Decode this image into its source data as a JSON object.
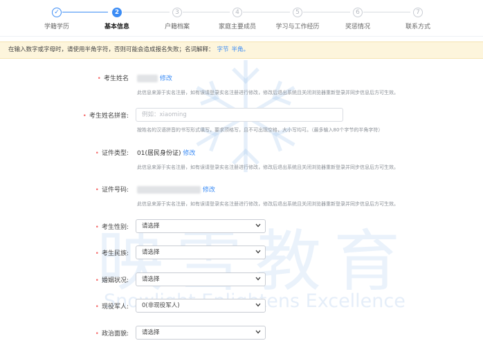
{
  "steps": [
    {
      "num": "✓",
      "label": "学籍学历",
      "state": "done"
    },
    {
      "num": "2",
      "label": "基本信息",
      "state": "active"
    },
    {
      "num": "3",
      "label": "户籍档案",
      "state": "todo"
    },
    {
      "num": "4",
      "label": "家庭主要成员",
      "state": "todo"
    },
    {
      "num": "5",
      "label": "学习与工作经历",
      "state": "todo"
    },
    {
      "num": "6",
      "label": "奖惩情况",
      "state": "todo"
    },
    {
      "num": "7",
      "label": "联系方式",
      "state": "todo"
    }
  ],
  "notice": {
    "text": "在输入数字或字母时，请使用半角字符，否则可能会造成报名失败；名词解释：",
    "link1": "字节",
    "link2": "半角。"
  },
  "form": {
    "name": {
      "label": "考生姓名",
      "edit": "修改",
      "hint": "此信息来源于实名注册，如有误请登录实名注册进行修改，修改后退出系统且关闭浏览器重新登录并同步信息后方可生效。"
    },
    "pinyin": {
      "label": "考生姓名拼音:",
      "placeholder": "例如：xiaoming",
      "hint": "按姓名的汉语拼音的书写形式填写，要求顶格写，且不可出现空格，大小写均可。（最多输入80个字节的半角字符）"
    },
    "id_type": {
      "label": "证件类型:",
      "value": "01(居民身份证)",
      "edit": "修改",
      "hint": "此信息来源于实名注册，如有误请登录实名注册进行修改，修改后退出系统且关闭浏览器重新登录并同步信息后方可生效。"
    },
    "id_number": {
      "label": "证件号码:",
      "edit": "修改",
      "hint": "此信息来源于实名注册，如有误请登录实名注册进行修改，修改后退出系统且关闭浏览器重新登录并同步信息后方可生效。"
    },
    "gender": {
      "label": "考生性别:",
      "value": "请选择"
    },
    "ethnicity": {
      "label": "考生民族:",
      "value": "请选择"
    },
    "marital": {
      "label": "婚姻状况:",
      "value": "请选择"
    },
    "military": {
      "label": "现役军人:",
      "value": "0(非现役军人)"
    },
    "political": {
      "label": "政治面貌:",
      "value": "请选择"
    }
  },
  "watermark": {
    "cn": "映雪教育",
    "en": "Snowlight Enlightens Excellence"
  },
  "colors": {
    "accent": "#3b8cf5",
    "required": "#f56c6c",
    "notice_bg": "#fdf5dc"
  },
  "icons": {
    "step1": "check-icon",
    "select": "chevron-down-icon"
  }
}
